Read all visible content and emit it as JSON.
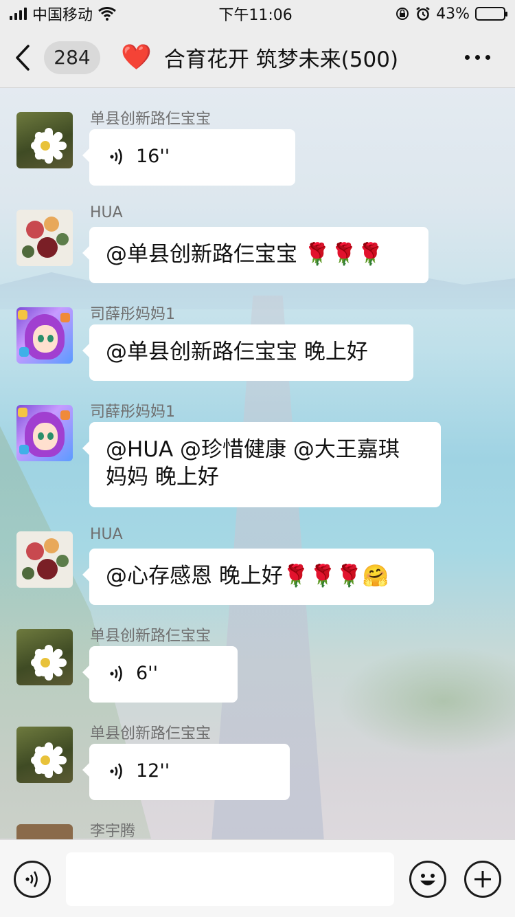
{
  "status_bar": {
    "carrier": "中国移动",
    "time": "下午11:06",
    "battery_percent": "43%",
    "battery_level": 0.43,
    "icons": [
      "signal-icon",
      "wifi-icon",
      "orientation-lock-icon",
      "alarm-icon",
      "battery-icon"
    ]
  },
  "header": {
    "unread_count": "284",
    "title": "合育花开 筑梦未来(500)",
    "title_emoji": "❤️",
    "icons": [
      "back-chevron-icon",
      "more-dots-icon"
    ]
  },
  "messages": [
    {
      "sender": "单县创新路仨宝宝",
      "type": "voice",
      "duration": "16''"
    },
    {
      "sender": "HUA",
      "type": "text",
      "text": "@单县创新路仨宝宝 🌹🌹🌹"
    },
    {
      "sender": "司薛彤妈妈1",
      "type": "text",
      "text": "@单县创新路仨宝宝 晚上好"
    },
    {
      "sender": "司薛彤妈妈1",
      "type": "text",
      "line1": "@HUA @珍惜健康 @大王嘉琪",
      "line2": "妈妈 晚上好"
    },
    {
      "sender": "HUA",
      "type": "text",
      "text": "@心存感恩 晚上好🌹🌹🌹🤗"
    },
    {
      "sender": "单县创新路仨宝宝",
      "type": "voice",
      "duration": "6''"
    },
    {
      "sender": "单县创新路仨宝宝",
      "type": "voice",
      "duration": "12''"
    },
    {
      "sender": "李宇腾"
    }
  ],
  "input_bar": {
    "icons": [
      "voice-input-icon",
      "emoji-icon",
      "plus-icon"
    ]
  }
}
